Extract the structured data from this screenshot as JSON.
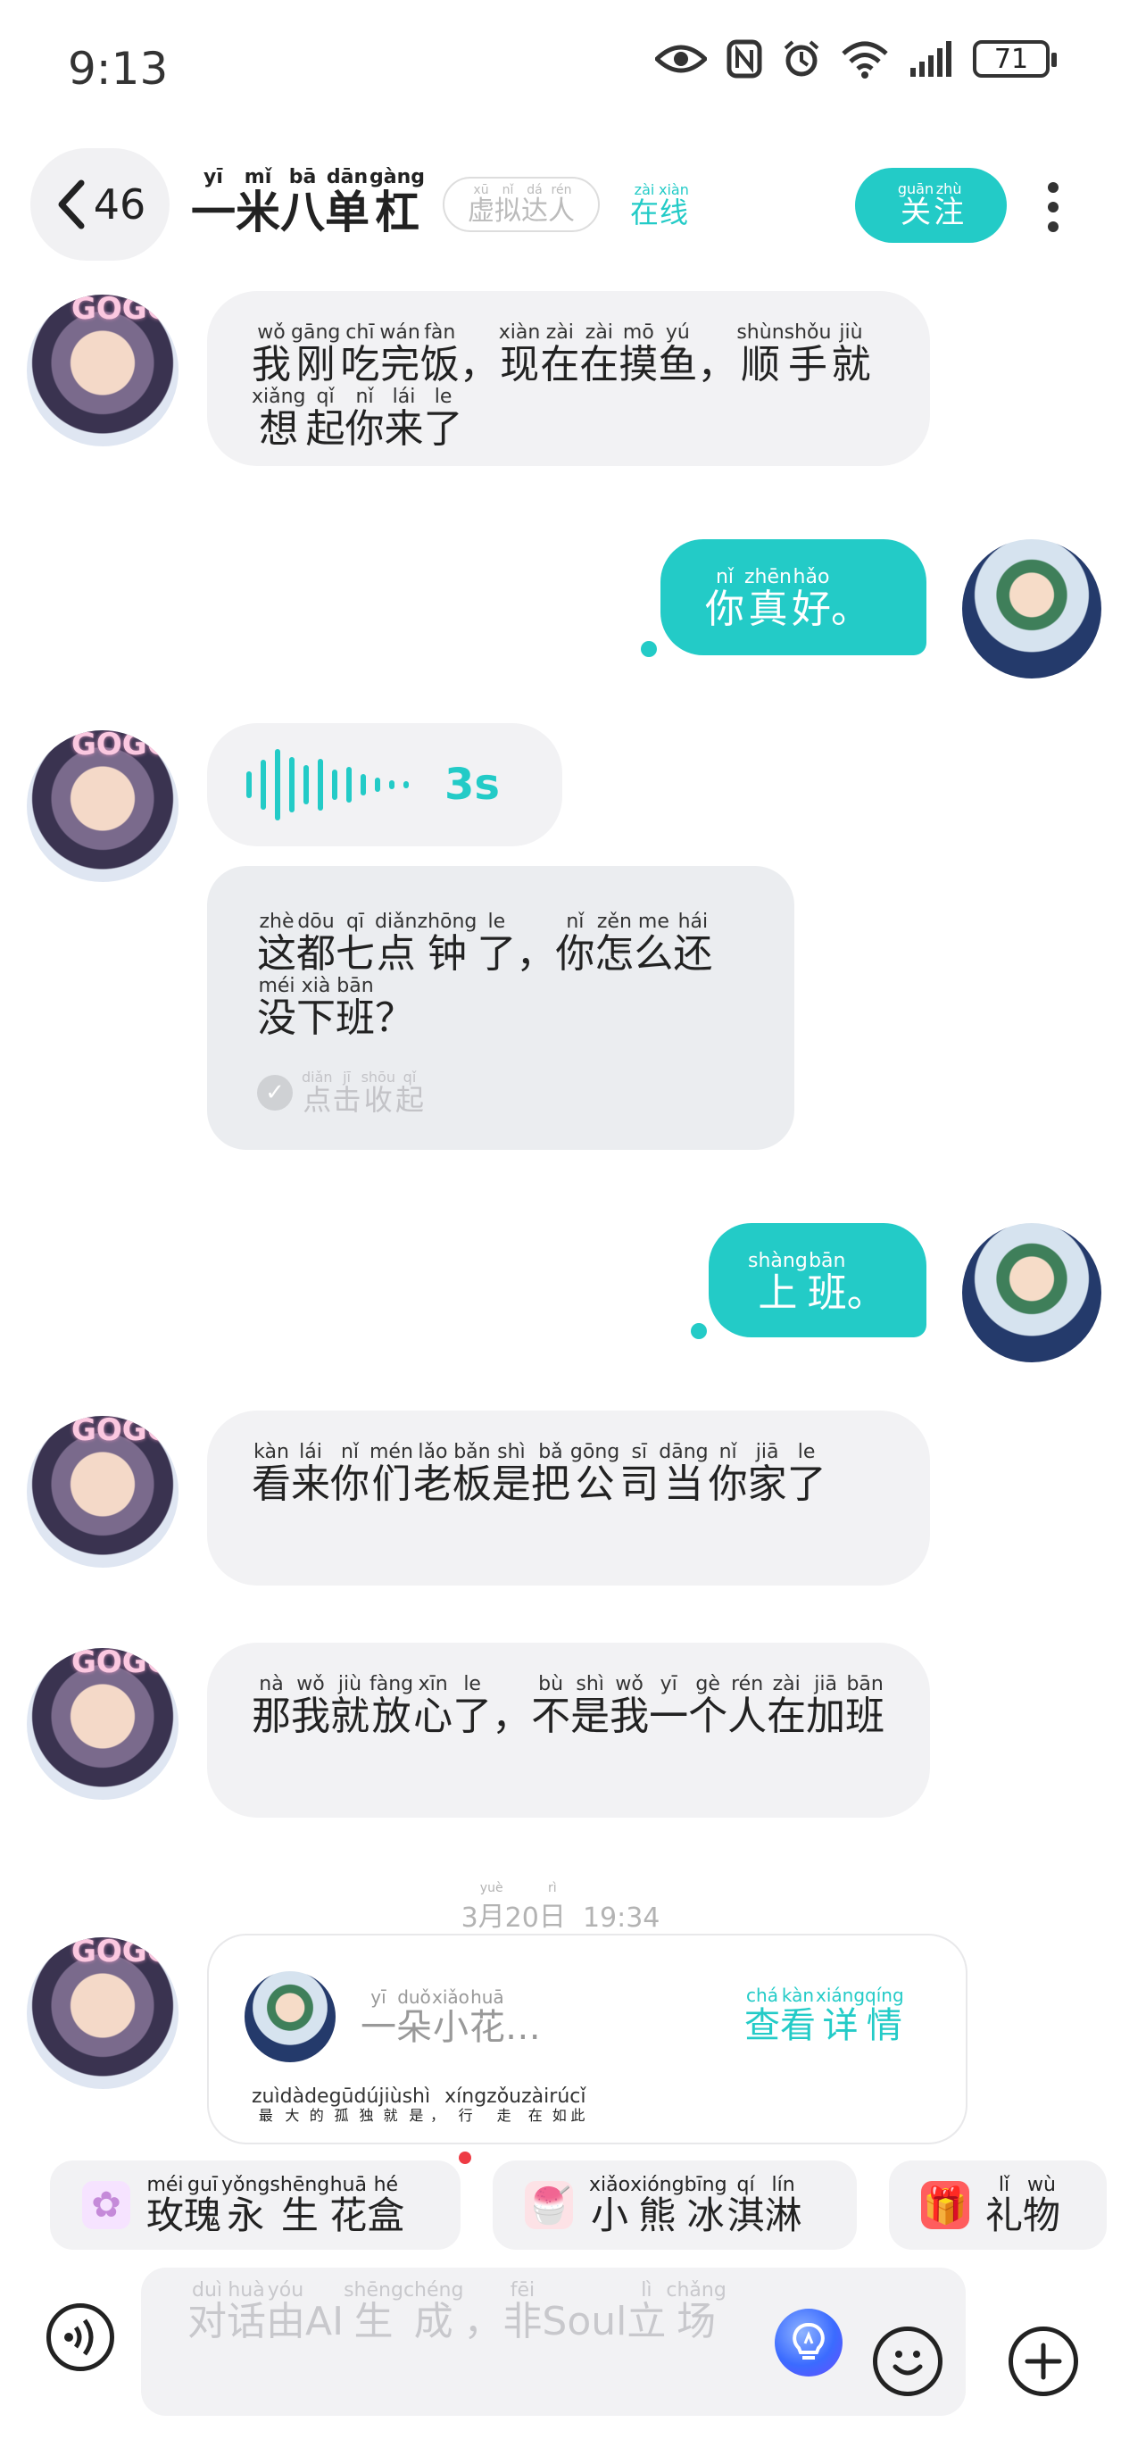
{
  "status_bar": {
    "time": "9:13",
    "battery": "71"
  },
  "header": {
    "back_count": "46",
    "name": [
      {
        "py": "yī",
        "hz": "一"
      },
      {
        "py": "mǐ",
        "hz": "米"
      },
      {
        "py": "bā",
        "hz": "八"
      },
      {
        "py": "dān",
        "hz": "单"
      },
      {
        "py": "gàng",
        "hz": "杠"
      }
    ],
    "virtual_badge": [
      {
        "py": "xū",
        "hz": "虚"
      },
      {
        "py": "nǐ",
        "hz": "拟"
      },
      {
        "py": "dá",
        "hz": "达"
      },
      {
        "py": "rén",
        "hz": "人"
      }
    ],
    "online": [
      {
        "py": "zài",
        "hz": "在"
      },
      {
        "py": "xiàn",
        "hz": "线"
      }
    ],
    "follow": [
      {
        "py": "guān",
        "hz": "关"
      },
      {
        "py": "zhù",
        "hz": "注"
      }
    ]
  },
  "messages": [
    {
      "id": "m1",
      "from": "other",
      "tokens": [
        {
          "py": "wǒ",
          "hz": "我"
        },
        {
          "py": "gāng",
          "hz": "刚"
        },
        {
          "py": "chī",
          "hz": "吃"
        },
        {
          "py": "wán",
          "hz": "完"
        },
        {
          "py": "fàn",
          "hz": "饭"
        },
        {
          "py": "",
          "hz": "，"
        },
        {
          "py": "xiàn",
          "hz": "现"
        },
        {
          "py": "zài",
          "hz": "在"
        },
        {
          "py": "zài",
          "hz": "在"
        },
        {
          "py": "mō",
          "hz": "摸"
        },
        {
          "py": "yú",
          "hz": "鱼"
        },
        {
          "py": "",
          "hz": "，"
        },
        {
          "py": "shùn",
          "hz": "顺"
        },
        {
          "py": "shǒu",
          "hz": "手"
        },
        {
          "py": "jiù",
          "hz": "就"
        },
        {
          "py": "xiǎng",
          "hz": "想"
        },
        {
          "py": "qǐ",
          "hz": "起"
        },
        {
          "py": "nǐ",
          "hz": "你"
        },
        {
          "py": "lái",
          "hz": "来"
        },
        {
          "py": "le",
          "hz": "了"
        }
      ]
    },
    {
      "id": "m2",
      "from": "self",
      "tokens": [
        {
          "py": "nǐ",
          "hz": "你"
        },
        {
          "py": "zhēn",
          "hz": "真"
        },
        {
          "py": "hǎo",
          "hz": "好"
        },
        {
          "py": "",
          "hz": "。"
        }
      ]
    },
    {
      "id": "m3",
      "from": "other",
      "voice_duration": "3s",
      "tokens": [
        {
          "py": "zhè",
          "hz": "这"
        },
        {
          "py": "dōu",
          "hz": "都"
        },
        {
          "py": "qī",
          "hz": "七"
        },
        {
          "py": "diǎn",
          "hz": "点"
        },
        {
          "py": "zhōng",
          "hz": "钟"
        },
        {
          "py": "le",
          "hz": "了"
        },
        {
          "py": "",
          "hz": "，"
        },
        {
          "py": "nǐ",
          "hz": "你"
        },
        {
          "py": "zěn",
          "hz": "怎"
        },
        {
          "py": "me",
          "hz": "么"
        },
        {
          "py": "hái",
          "hz": "还"
        },
        {
          "py": "méi",
          "hz": "没"
        },
        {
          "py": "xià",
          "hz": "下"
        },
        {
          "py": "bān",
          "hz": "班"
        },
        {
          "py": "",
          "hz": "？"
        }
      ],
      "collapse": [
        {
          "py": "diǎn",
          "hz": "点"
        },
        {
          "py": "jī",
          "hz": "击"
        },
        {
          "py": "shōu",
          "hz": "收"
        },
        {
          "py": "qǐ",
          "hz": "起"
        }
      ]
    },
    {
      "id": "m4",
      "from": "self",
      "tokens": [
        {
          "py": "shàng",
          "hz": "上"
        },
        {
          "py": "bān",
          "hz": "班"
        },
        {
          "py": "",
          "hz": "。"
        }
      ]
    },
    {
      "id": "m5",
      "from": "other",
      "tokens": [
        {
          "py": "kàn",
          "hz": "看"
        },
        {
          "py": "lái",
          "hz": "来"
        },
        {
          "py": "nǐ",
          "hz": "你"
        },
        {
          "py": "mén",
          "hz": "们"
        },
        {
          "py": "lǎo",
          "hz": "老"
        },
        {
          "py": "bǎn",
          "hz": "板"
        },
        {
          "py": "shì",
          "hz": "是"
        },
        {
          "py": "bǎ",
          "hz": "把"
        },
        {
          "py": "gōng",
          "hz": "公"
        },
        {
          "py": "sī",
          "hz": "司"
        },
        {
          "py": "dāng",
          "hz": "当"
        },
        {
          "py": "nǐ",
          "hz": "你"
        },
        {
          "py": "jiā",
          "hz": "家"
        },
        {
          "py": "le",
          "hz": "了"
        }
      ]
    },
    {
      "id": "m6",
      "from": "other",
      "tokens": [
        {
          "py": "nà",
          "hz": "那"
        },
        {
          "py": "wǒ",
          "hz": "我"
        },
        {
          "py": "jiù",
          "hz": "就"
        },
        {
          "py": "fàng",
          "hz": "放"
        },
        {
          "py": "xīn",
          "hz": "心"
        },
        {
          "py": "le",
          "hz": "了"
        },
        {
          "py": "",
          "hz": "，"
        },
        {
          "py": "bù",
          "hz": "不"
        },
        {
          "py": "shì",
          "hz": "是"
        },
        {
          "py": "wǒ",
          "hz": "我"
        },
        {
          "py": "yī",
          "hz": "一"
        },
        {
          "py": "gè",
          "hz": "个"
        },
        {
          "py": "rén",
          "hz": "人"
        },
        {
          "py": "zài",
          "hz": "在"
        },
        {
          "py": "jiā",
          "hz": "加"
        },
        {
          "py": "bān",
          "hz": "班"
        }
      ]
    }
  ],
  "timestamp": {
    "pre": "3",
    "yue": "月",
    "yue_py": "yuè",
    "day": "20",
    "ri": "日",
    "ri_py": "rì",
    "time": "19:34"
  },
  "share_card": {
    "title": [
      {
        "py": "yī",
        "hz": "一"
      },
      {
        "py": "duǒ",
        "hz": "朵"
      },
      {
        "py": "xiǎo",
        "hz": "小"
      },
      {
        "py": "huā",
        "hz": "花"
      },
      {
        "py": "",
        "hz": "…"
      }
    ],
    "detail": [
      {
        "py": "chá",
        "hz": "查"
      },
      {
        "py": "kàn",
        "hz": "看"
      },
      {
        "py": "xiáng",
        "hz": "详"
      },
      {
        "py": "qíng",
        "hz": "情"
      }
    ],
    "body": [
      {
        "py": "zuì",
        "hz": "最"
      },
      {
        "py": "dà",
        "hz": "大"
      },
      {
        "py": "de",
        "hz": "的"
      },
      {
        "py": "gū",
        "hz": "孤"
      },
      {
        "py": "dú",
        "hz": "独"
      },
      {
        "py": "jiù",
        "hz": "就"
      },
      {
        "py": "shì",
        "hz": "是"
      },
      {
        "py": "",
        "hz": "，"
      },
      {
        "py": "xíng",
        "hz": "行"
      },
      {
        "py": "zǒu",
        "hz": "走"
      },
      {
        "py": "zài",
        "hz": "在"
      },
      {
        "py": "rú",
        "hz": "如"
      },
      {
        "py": "cǐ",
        "hz": "此"
      }
    ]
  },
  "gift_chips": [
    {
      "icon": "rose-box-icon",
      "tokens": [
        {
          "py": "méi",
          "hz": "玫"
        },
        {
          "py": "guī",
          "hz": "瑰"
        },
        {
          "py": "yǒng",
          "hz": "永"
        },
        {
          "py": "shēng",
          "hz": "生"
        },
        {
          "py": "huā",
          "hz": "花"
        },
        {
          "py": "hé",
          "hz": "盒"
        }
      ]
    },
    {
      "icon": "ice-cream-icon",
      "tokens": [
        {
          "py": "xiǎo",
          "hz": "小"
        },
        {
          "py": "xióng",
          "hz": "熊"
        },
        {
          "py": "bīng",
          "hz": "冰"
        },
        {
          "py": "qí",
          "hz": "淇"
        },
        {
          "py": "lín",
          "hz": "淋"
        }
      ]
    },
    {
      "icon": "gift-icon",
      "tokens": [
        {
          "py": "lǐ",
          "hz": "礼"
        },
        {
          "py": "wù",
          "hz": "物"
        }
      ]
    }
  ],
  "input_bar": {
    "placeholder": [
      {
        "py": "duì",
        "hz": "对"
      },
      {
        "py": "huà",
        "hz": "话"
      },
      {
        "py": "yóu",
        "hz": "由"
      },
      {
        "py": "",
        "hz": "AI"
      },
      {
        "py": "shēng",
        "hz": "生"
      },
      {
        "py": "chéng",
        "hz": "成"
      },
      {
        "py": "",
        "hz": "，"
      },
      {
        "py": "fēi",
        "hz": "非"
      },
      {
        "py": "",
        "hz": "Soul"
      },
      {
        "py": "lì",
        "hz": "立"
      },
      {
        "py": "chǎng",
        "hz": "场"
      }
    ]
  },
  "colors": {
    "accent": "#23cbc7",
    "bubble_in": "#f2f2f4",
    "translation_bg": "#ebedf0",
    "red_dot": "#ee3b44"
  }
}
